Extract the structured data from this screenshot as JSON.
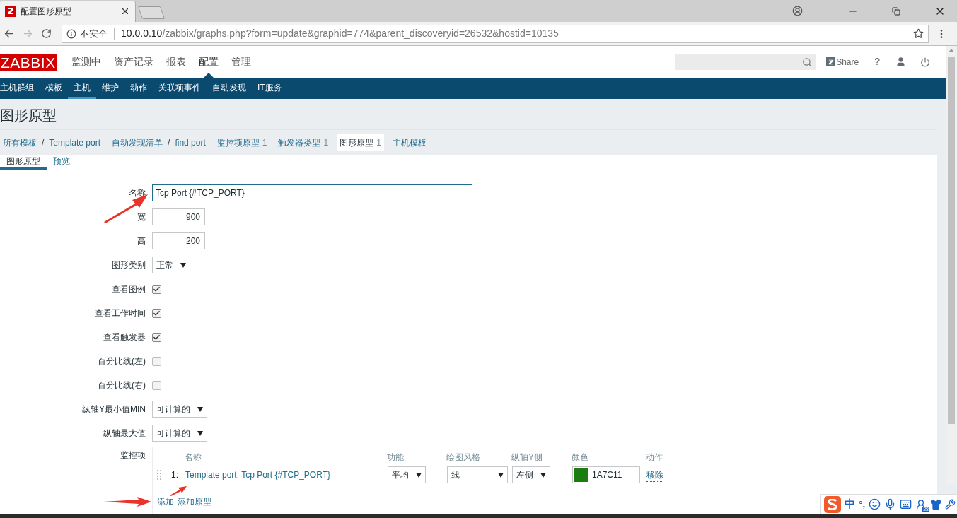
{
  "browser": {
    "tab_title": "配置图形原型",
    "security_label": "不安全",
    "url_host": "10.0.0.10",
    "url_path": "/zabbix/graphs.php?form=update&graphid=774&parent_discoveryid=26532&hostid=10135"
  },
  "header": {
    "logo": "ZABBIX",
    "menu": [
      {
        "label": "监测中",
        "selected": false
      },
      {
        "label": "资产记录",
        "selected": false
      },
      {
        "label": "报表",
        "selected": false
      },
      {
        "label": "配置",
        "selected": true
      },
      {
        "label": "管理",
        "selected": false
      }
    ],
    "share": "Share",
    "help": "?"
  },
  "submenu": [
    {
      "label": "主机群组",
      "selected": false
    },
    {
      "label": "模板",
      "selected": false
    },
    {
      "label": "主机",
      "selected": true
    },
    {
      "label": "维护",
      "selected": false
    },
    {
      "label": "动作",
      "selected": false
    },
    {
      "label": "关联项事件",
      "selected": false
    },
    {
      "label": "自动发现",
      "selected": false
    },
    {
      "label": "IT服务",
      "selected": false
    }
  ],
  "page_title": "图形原型",
  "breadcrumbs": [
    {
      "label": "所有模板",
      "separator": "/",
      "selected": false
    },
    {
      "label": "Template port",
      "selected": false
    },
    {
      "label": "自动发现清单",
      "separator": "/",
      "selected": false
    },
    {
      "label": "find port",
      "selected": false
    },
    {
      "label": "监控项原型",
      "count": "1",
      "selected": false
    },
    {
      "label": "触发器类型",
      "count": "1",
      "selected": false
    },
    {
      "label": "图形原型",
      "count": "1",
      "selected": true
    },
    {
      "label": "主机模板",
      "selected": false
    }
  ],
  "tabs": [
    {
      "label": "图形原型",
      "selected": true
    },
    {
      "label": "预览",
      "selected": false
    }
  ],
  "form": {
    "fields": [
      {
        "kind": "text",
        "label": "名称",
        "value": "Tcp Port {#TCP_PORT}"
      },
      {
        "kind": "number",
        "label": "宽",
        "value": "900"
      },
      {
        "kind": "number",
        "label": "高",
        "value": "200"
      },
      {
        "kind": "select",
        "label": "图形类别",
        "value": "正常"
      },
      {
        "kind": "checkbox",
        "label": "查看图例",
        "checked": true
      },
      {
        "kind": "checkbox",
        "label": "查看工作时间",
        "checked": true
      },
      {
        "kind": "checkbox",
        "label": "查看触发器",
        "checked": true
      },
      {
        "kind": "checkbox",
        "label": "百分比线(左)",
        "checked": false
      },
      {
        "kind": "checkbox",
        "label": "百分比线(右)",
        "checked": false
      },
      {
        "kind": "select",
        "label": "纵轴Y最小值MIN",
        "value": "可计算的"
      },
      {
        "kind": "select",
        "label": "纵轴最大值",
        "value": "可计算的"
      }
    ],
    "items": {
      "label": "监控项",
      "columns": [
        "名称",
        "功能",
        "绘图风格",
        "纵轴Y侧",
        "颜色",
        "动作"
      ],
      "rows": [
        {
          "index": "1:",
          "name": "Template port: Tcp Port {#TCP_PORT}",
          "function": "平均",
          "draw_style": "线",
          "y_axis_side": "左侧",
          "color": "#1a7c11",
          "color_code": "1A7C11",
          "action": "移除"
        }
      ],
      "links": [
        "添加",
        "添加原型"
      ]
    }
  },
  "ime": {
    "mode": "中",
    "punct": "°,",
    "badge": "28"
  }
}
